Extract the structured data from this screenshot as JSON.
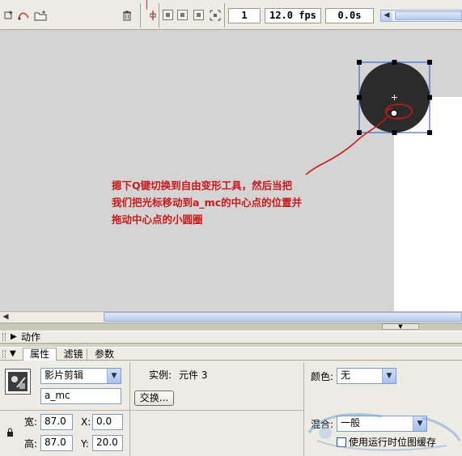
{
  "timeline": {
    "frame": "1",
    "fps": "12.0 fps",
    "time": "0.0s"
  },
  "annotation": {
    "text": "摁下Q键切换到自由变形工具，然后当把\n我们把光标移动到a_mc的中心点的位置并\n拖动中心点的小圆圈"
  },
  "panels": {
    "actions_title": "动作"
  },
  "tabs": [
    {
      "label": "属性",
      "active": true
    },
    {
      "label": "滤镜",
      "active": false
    },
    {
      "label": "参数",
      "active": false
    }
  ],
  "properties": {
    "symbol_type": "影片剪辑",
    "instance_name": "a_mc",
    "instance_label": "实例:",
    "instance_value": "元件 3",
    "swap_button": "交换...",
    "width_label": "宽:",
    "width_value": "87.0",
    "height_label": "高:",
    "height_value": "87.0",
    "x_label": "X:",
    "x_value": "0.0",
    "y_label": "Y:",
    "y_value": "20.0",
    "color_label": "颜色:",
    "color_value": "无",
    "blend_label": "混合:",
    "blend_value": "一般",
    "cache_label": "使用运行时位图缓存"
  },
  "colors": {
    "circle_fill": "#2b2b2b",
    "annotation_red": "#c81818",
    "stage_bg": "#d4d4d4",
    "panel_bg": "#ecebe4"
  }
}
